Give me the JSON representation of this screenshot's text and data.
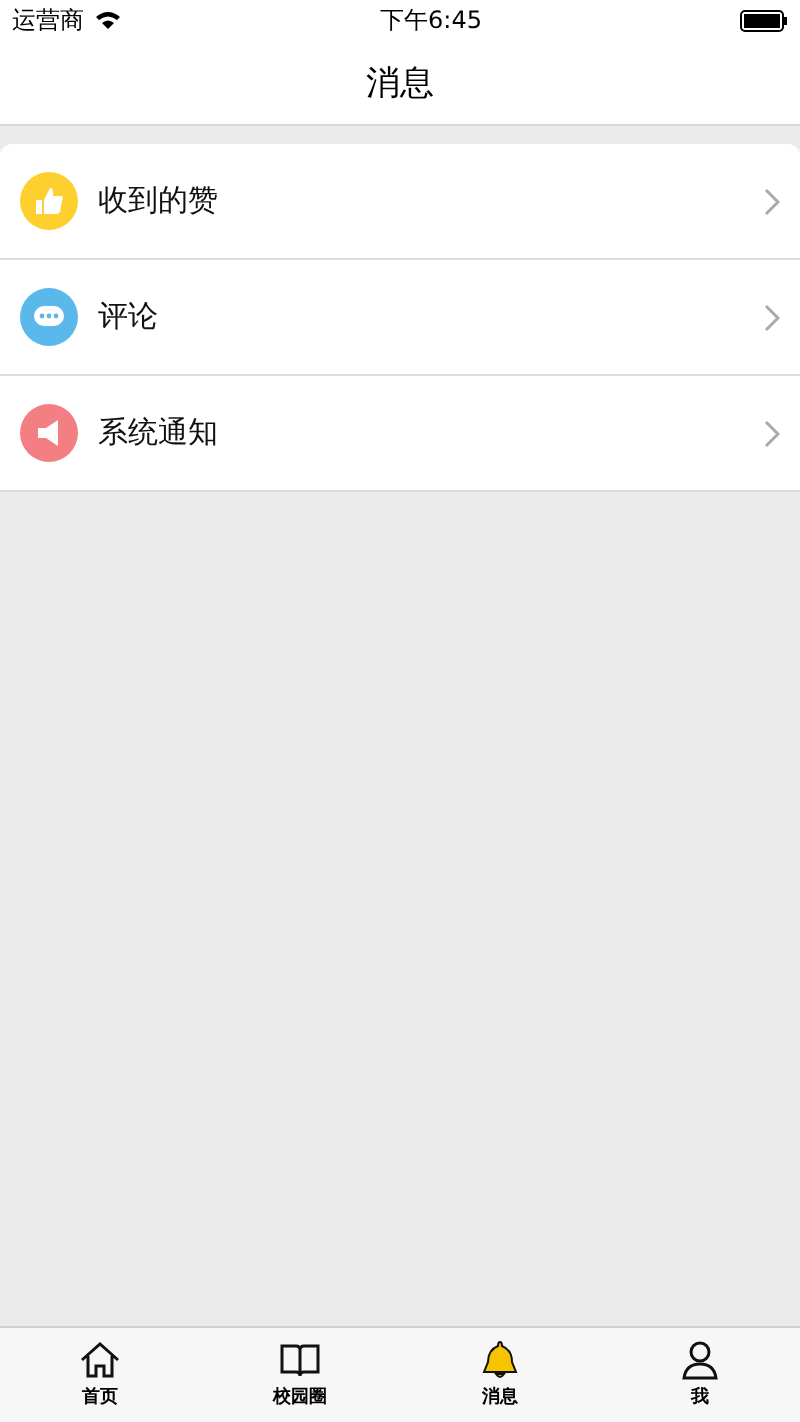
{
  "status_bar": {
    "carrier": "运营商",
    "time": "下午6:45"
  },
  "nav_bar": {
    "title": "消息"
  },
  "messages": [
    {
      "label": "收到的赞",
      "kind": "like",
      "color": "#fdd02f"
    },
    {
      "label": "评论",
      "kind": "comment",
      "color": "#5bb8ea"
    },
    {
      "label": "系统通知",
      "kind": "notice",
      "color": "#f47f82"
    }
  ],
  "tab_bar": [
    {
      "label": "首页",
      "kind": "home",
      "selected": false
    },
    {
      "label": "校园圈",
      "kind": "book",
      "selected": false
    },
    {
      "label": "消息",
      "kind": "bell",
      "selected": true
    },
    {
      "label": "我",
      "kind": "person",
      "selected": false
    }
  ]
}
